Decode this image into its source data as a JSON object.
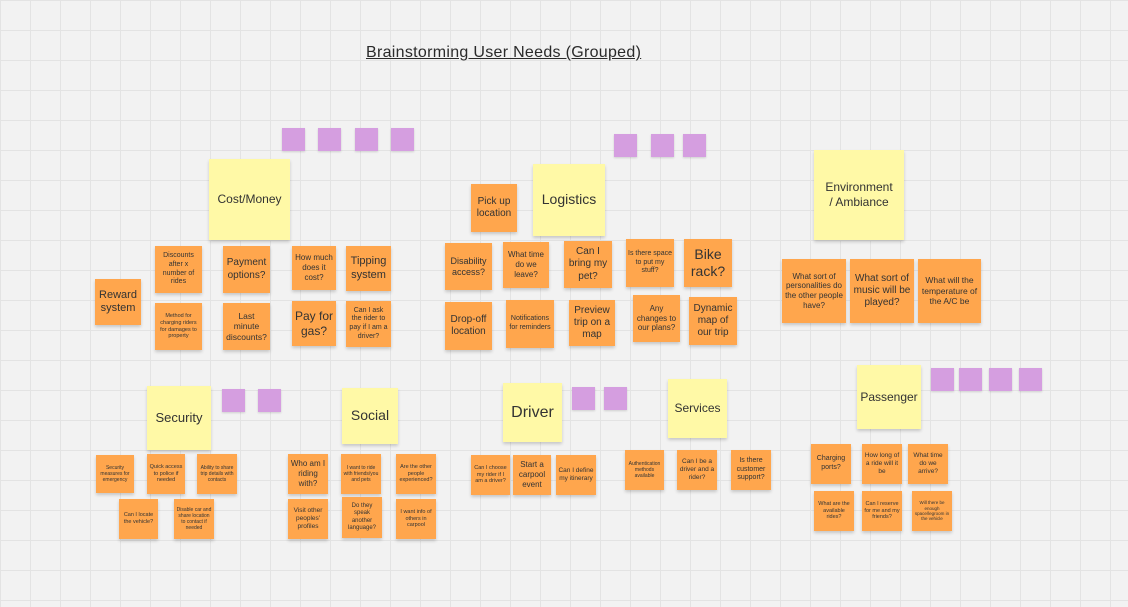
{
  "board": {
    "title": "Brainstorming User Needs (Grouped)",
    "colors": {
      "sticky_orange": "#ffa64d",
      "sticky_yellow": "#fff9a6",
      "dot_purple": "#d59ee0",
      "background": "#f2f2f2"
    }
  },
  "groups": {
    "cost": {
      "header": "Cost/Money",
      "notes": [
        "Reward system",
        "Discounts after x number of rides",
        "Payment options?",
        "How much does it cost?",
        "Tipping system",
        "Method for charging riders for damages to property",
        "Last minute discounts?",
        "Pay for gas?",
        "Can I ask the rider to pay if I am a driver?"
      ]
    },
    "logistics": {
      "header": "Logistics",
      "notes": [
        "Pick up location",
        "Disability access?",
        "What time do we leave?",
        "Can I bring my pet?",
        "Is there space to put my stuff?",
        "Bike rack?",
        "Drop-off location",
        "Notifications for reminders",
        "Preview trip on a map",
        "Any changes to our plans?",
        "Dynamic map of our trip"
      ]
    },
    "environment": {
      "header": "Environment / Ambiance",
      "notes": [
        "What sort of personalities do the other people have?",
        "What sort of music will be played?",
        "What will the temperature of the A/C be"
      ]
    },
    "security": {
      "header": "Security",
      "notes": [
        "Security measures for emergency",
        "Quick access to police if needed",
        "Ability to share trip details with contacts",
        "Can I locate the vehicle?",
        "Disable car and share location to contact if needed"
      ]
    },
    "social": {
      "header": "Social",
      "notes": [
        "Who am I riding with?",
        "I want to ride with friends/you and pets",
        "Are the other people experienced?",
        "Visit other peoples' profiles",
        "Do they speak another language?",
        "I want info of others in carpool"
      ]
    },
    "driver": {
      "header": "Driver",
      "notes": [
        "Can I choose my rider if I am a driver?",
        "Start a carpool event",
        "Can I define my itinerary"
      ]
    },
    "services": {
      "header": "Services",
      "notes": [
        "Authentication methods available",
        "Can I be a driver and a rider?",
        "Is there customer support?"
      ]
    },
    "passenger": {
      "header": "Passenger",
      "notes": [
        "Charging ports?",
        "How long of a ride will it be",
        "What time do we arrive?",
        "What are the available rides?",
        "Can I reserve for me and my friends?",
        "Will there be enough space/legroom in the vehicle"
      ]
    }
  }
}
